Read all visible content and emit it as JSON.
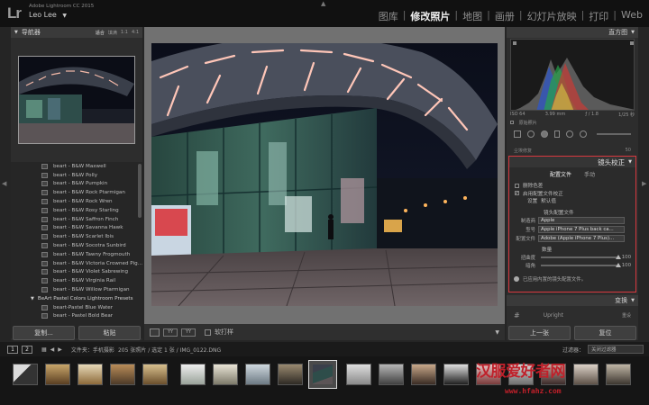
{
  "header": {
    "logo": "Lr",
    "app_name": "Adobe Lightroom CC 2015",
    "user": "Leo Lee",
    "user_caret": "▼",
    "modules": [
      "图库",
      "修改照片",
      "地图",
      "画册",
      "幻灯片放映",
      "打印",
      "Web"
    ],
    "active_module": 1
  },
  "navigator": {
    "title": "导航器",
    "options": [
      "适合",
      "填满",
      "1:1",
      "4:1"
    ]
  },
  "presets": [
    "beart - B&W Maxwell",
    "beart - B&W Polly",
    "beart - B&W Pumpkin",
    "beart - B&W Rock Ptarmigan",
    "beart - B&W Rock Wren",
    "beart - B&W Rosy Starling",
    "beart - B&W Saffron Finch",
    "beart - B&W Savanna Hawk",
    "beart - B&W Scarlet Ibis",
    "beart - B&W Socotra Sunbird",
    "beart - B&W Tawny Frogmouth",
    "beart - B&W Victoria Crowned Pig...",
    "beart - B&W Violet Sabrewing",
    "beart - B&W Virginia Rail",
    "beart - B&W Willow Ptarmigan"
  ],
  "preset_folder": "BeArt Pastel Colors Lightroom Presets",
  "preset_after_folder": [
    "beart-Pastel Blue Water",
    "beart - Pastel Bold Bear"
  ],
  "left_buttons": {
    "copy": "复制...",
    "paste": "粘贴"
  },
  "toolbar": {
    "softproof": "软打样"
  },
  "histogram": {
    "title": "直方图",
    "iso": "ISO 64",
    "focal": "3.99 mm",
    "aperture": "ƒ / 1.8",
    "shutter": "1/25 秒",
    "original": "原始照片"
  },
  "clipped_row": {
    "left": "尘埃修复",
    "right": "50"
  },
  "lens_correction": {
    "title": "镜头校正",
    "tabs": [
      "配置文件",
      "手动"
    ],
    "remove_ca": "删除色差",
    "enable_profile": "启用配置文件校正",
    "setup_label": "设置",
    "setup_value": "默认值",
    "profile_section": "镜头配置文件",
    "make_label": "制造商",
    "make_value": "Apple",
    "model_label": "型号",
    "model_value": "Apple iPhone 7 Plus back ca...",
    "profile_label": "配置文件",
    "profile_value": "Adobe (Apple iPhone 7 Plus)...",
    "amount_label": "数量",
    "distortion_label": "扭曲度",
    "distortion_value": "100",
    "distortion_level": 100,
    "vignette_label": "暗角",
    "vignette_value": "100",
    "vignette_level": 100,
    "note": "已应用内置的镜头配置文件。"
  },
  "transform": {
    "title": "变换",
    "upright": "Upright",
    "reset": "重设"
  },
  "right_buttons": {
    "prev": "上一张",
    "reset": "复位"
  },
  "filmstrip": {
    "page1": "1",
    "page2": "2",
    "folder_label": "文件夹：手机摄影",
    "count": "205 张照片 / 选定 1 张 / IMG_0122.DNG",
    "filter_label": "过滤器：",
    "filter_value": "关闭过滤器"
  },
  "watermark": {
    "logo": "汉服爱好者网",
    "url": "www.hfahz.com"
  },
  "colors": {
    "accent": "#d8383f",
    "panel": "#2d2d2d",
    "bg": "#252525"
  }
}
